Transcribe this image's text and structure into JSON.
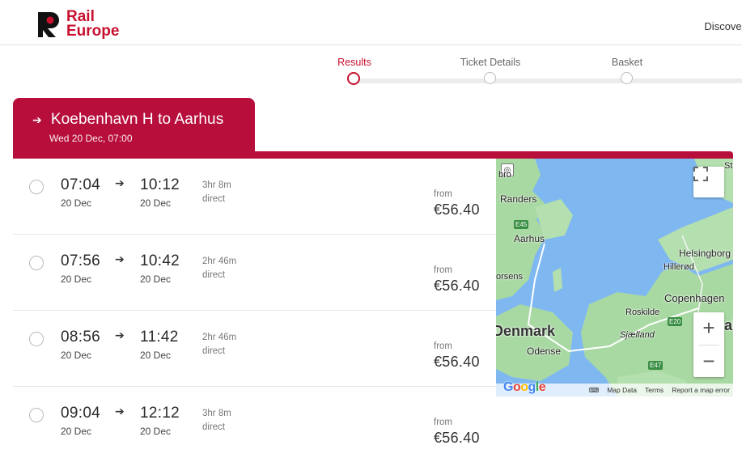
{
  "brand": {
    "line1": "Rail",
    "line2": "Europe",
    "color": "#c8102e"
  },
  "nav": {
    "discover": "Discover"
  },
  "stepper": {
    "steps": [
      {
        "label": "Results",
        "active": true
      },
      {
        "label": "Ticket Details",
        "active": false
      },
      {
        "label": "Basket",
        "active": false
      }
    ]
  },
  "route": {
    "title": "Koebenhavn H to Aarhus",
    "subtitle": "Wed 20 Dec, 07:00",
    "color": "#b70e3c"
  },
  "journeys": [
    {
      "dep_time": "07:04",
      "dep_date": "20 Dec",
      "arr_time": "10:12",
      "arr_date": "20 Dec",
      "duration": "3hr 8m",
      "type": "direct",
      "from_label": "from",
      "price": "€56.40"
    },
    {
      "dep_time": "07:56",
      "dep_date": "20 Dec",
      "arr_time": "10:42",
      "arr_date": "20 Dec",
      "duration": "2hr 46m",
      "type": "direct",
      "from_label": "from",
      "price": "€56.40"
    },
    {
      "dep_time": "08:56",
      "dep_date": "20 Dec",
      "arr_time": "11:42",
      "arr_date": "20 Dec",
      "duration": "2hr 46m",
      "type": "direct",
      "from_label": "from",
      "price": "€56.40"
    },
    {
      "dep_time": "09:04",
      "dep_date": "20 Dec",
      "arr_time": "12:12",
      "arr_date": "20 Dec",
      "duration": "3hr 8m",
      "type": "direct",
      "from_label": "from",
      "price": "€56.40"
    }
  ],
  "map": {
    "places": {
      "randers": "Randers",
      "aarhus": "Aarhus",
      "horsens": "orsens",
      "helsingor": "Helsingborg",
      "hillerod": "Hillerød",
      "copenhagen": "Copenhagen",
      "roskilde": "Roskilde",
      "denmark": "Denmark",
      "sjaelland": "Sjælland",
      "odense": "Odense",
      "sta": "Sta",
      "bro": "bro",
      "ala": "al"
    },
    "roads": {
      "e45": "E45",
      "e20": "E20",
      "e47": "E47"
    },
    "attribution": {
      "logo": "Google",
      "map_data": "Map Data",
      "terms": "Terms",
      "report": "Report a map error"
    },
    "zoom_in": "+",
    "zoom_out": "−"
  }
}
